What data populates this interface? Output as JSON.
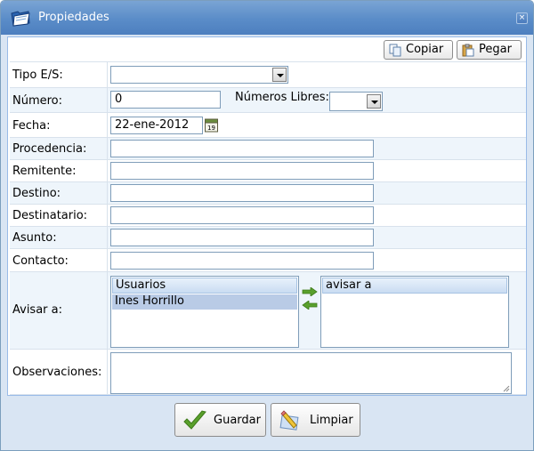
{
  "window": {
    "title": "Propiedades",
    "close_glyph": "×"
  },
  "toolbar": {
    "copy_label": "Copiar",
    "paste_label": "Pegar"
  },
  "form": {
    "tipo_label": "Tipo E/S:",
    "tipo_value": "",
    "numero_label": "Número:",
    "numero_value": "0",
    "libres_label": "Números Libres:",
    "libres_value": "",
    "fecha_label": "Fecha:",
    "fecha_value": "22-ene-2012",
    "calendar_day": "19",
    "procedencia_label": "Procedencia:",
    "procedencia_value": "",
    "remitente_label": "Remitente:",
    "remitente_value": "",
    "destino_label": "Destino:",
    "destino_value": "",
    "destinatario_label": "Destinatario:",
    "destinatario_value": "",
    "asunto_label": "Asunto:",
    "asunto_value": "",
    "contacto_label": "Contacto:",
    "contacto_value": "",
    "avisar_label": "Avisar a:",
    "users_header": "Usuarios",
    "users": [
      "Ines Horrillo"
    ],
    "avisar_header": "avisar a",
    "observaciones_label": "Observaciones:",
    "observaciones_value": ""
  },
  "actions": {
    "save_label": "Guardar",
    "clear_label": "Limpiar"
  },
  "icons": {
    "title": "folder-icon",
    "copy": "copy-icon",
    "paste": "paste-icon",
    "calendar": "calendar-icon",
    "move_right": "arrow-right-icon",
    "move_left": "arrow-left-icon",
    "save": "checkmark-icon",
    "clear": "eraser-icon"
  },
  "colors": {
    "title_bar": "#5a8cc8",
    "accent_green": "#5aa02c",
    "row_alt": "#eef5fb"
  }
}
